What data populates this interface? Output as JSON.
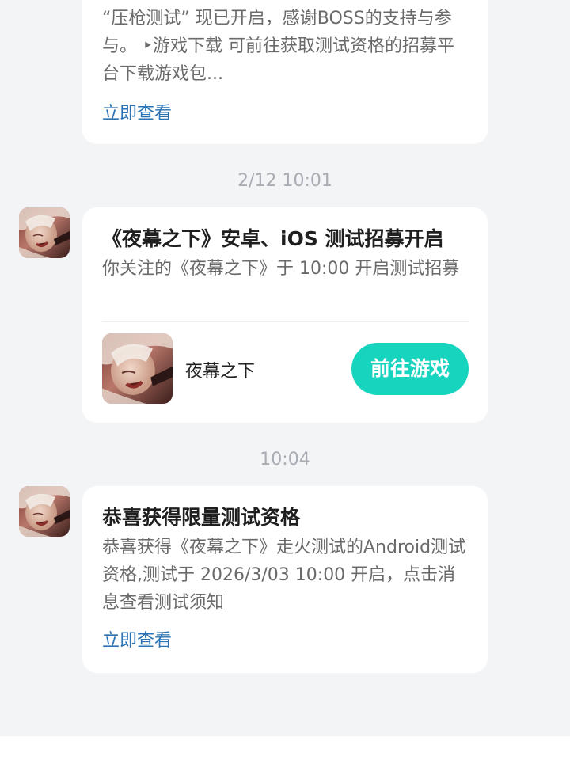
{
  "messages": [
    {
      "body": "“压枪测试” 现已开启，感谢BOSS的支持与参与。 ‣游戏下载 可前往获取测试资格的招募平台下载游戏包...",
      "link": "立即查看"
    },
    {
      "time": "2/12  10:01",
      "title": "《夜幕之下》安卓、iOS 测试招募开启",
      "body": "你关注的《夜幕之下》于 10:00 开启测试招募",
      "game_name": "夜幕之下",
      "button": "前往游戏"
    },
    {
      "time": "10:04",
      "title": "恭喜获得限量测试资格",
      "body": "恭喜获得《夜幕之下》走火测试的Android测试资格,测试于 2026/3/03 10:00 开启，点击消息查看测试须知",
      "link": "立即查看"
    }
  ],
  "colors": {
    "background": "#f3f4f6",
    "card": "#ffffff",
    "link": "#2a72b3",
    "button": "#17d4bf",
    "timestamp": "#a8adb3"
  },
  "icons": {
    "avatar": "game-avatar-artwork",
    "game": "game-cover-artwork"
  }
}
